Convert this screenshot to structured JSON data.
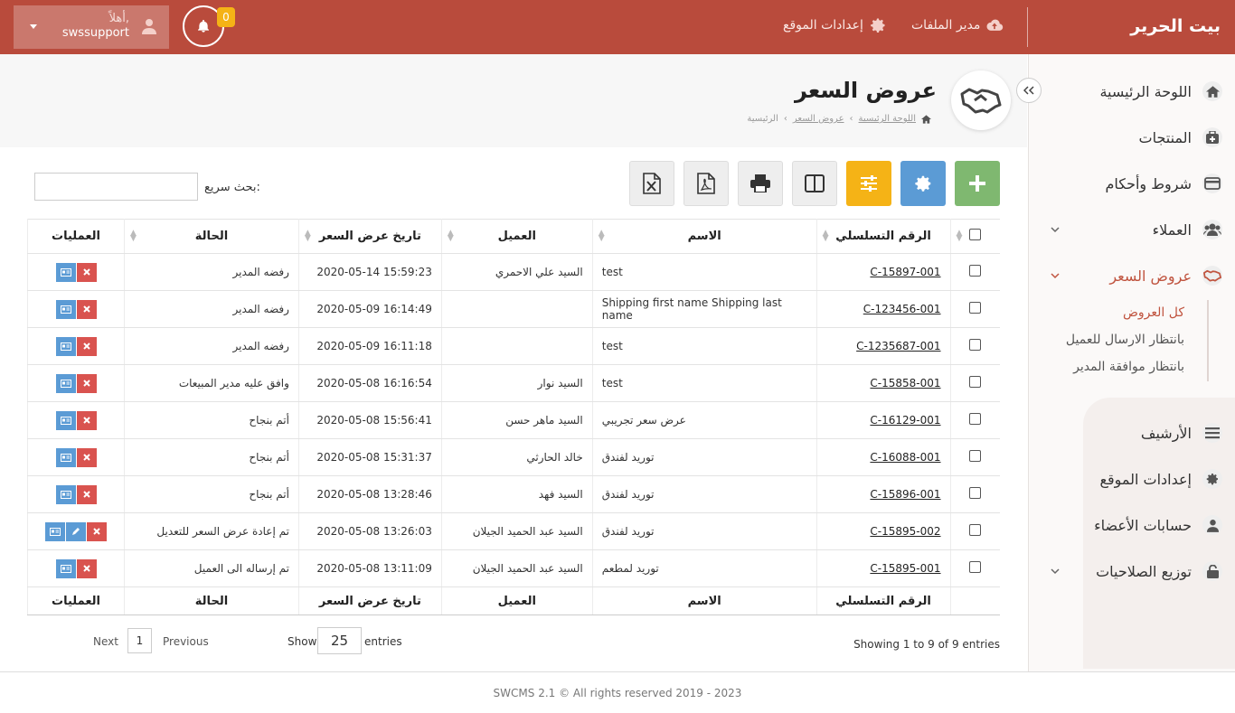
{
  "topbar": {
    "brand": "بيت الحرير",
    "file_manager": "مدير الملفات",
    "site_settings": "إعدادات الموقع",
    "notifications_count": "0",
    "greeting": "أهلاً,",
    "username": "swssupport"
  },
  "sidebar": {
    "items": [
      {
        "label": "اللوحة الرئيسية",
        "icon": "home-icon"
      },
      {
        "label": "المنتجات",
        "icon": "products-icon"
      },
      {
        "label": "شروط وأحكام",
        "icon": "terms-icon"
      },
      {
        "label": "العملاء",
        "icon": "users-icon"
      },
      {
        "label": "عروض السعر",
        "icon": "handshake-icon"
      },
      {
        "label": "الأرشيف",
        "icon": "archive-icon"
      },
      {
        "label": "إعدادات الموقع",
        "icon": "gear-icon"
      },
      {
        "label": "حسابات الأعضاء",
        "icon": "user-icon"
      },
      {
        "label": "توزيع الصلاحيات",
        "icon": "lock-icon"
      }
    ],
    "sub_items": [
      "كل العروض",
      "بانتظار الارسال للعميل",
      "بانتظار موافقة المدير"
    ]
  },
  "page": {
    "title": "عروض السعر",
    "breadcrumb": [
      "اللوحة الرئيسية",
      "عروض السعر",
      "الرئيسية"
    ]
  },
  "toolbar": {
    "search_label": "بحث سريع:",
    "search_value": ""
  },
  "table": {
    "headers": [
      "الرقم التسلسلي",
      "الاسم",
      "العميل",
      "تاريخ عرض السعر",
      "الحالة",
      "العمليات"
    ],
    "rows": [
      {
        "serial": "C-15897-001",
        "name": "test",
        "client": "السيد علي الاحمري",
        "date": "2020-05-14 15:59:23",
        "status": "رفضه المدير",
        "edit": false
      },
      {
        "serial": "C-123456-001",
        "name": "Shipping first name Shipping last name",
        "client": "",
        "date": "2020-05-09 16:14:49",
        "status": "رفضه المدير",
        "edit": false
      },
      {
        "serial": "C-1235687-001",
        "name": "test",
        "client": "",
        "date": "2020-05-09 16:11:18",
        "status": "رفضه المدير",
        "edit": false
      },
      {
        "serial": "C-15858-001",
        "name": "test",
        "client": "السيد نوار",
        "date": "2020-05-08 16:16:54",
        "status": "وافق عليه مدير المبيعات",
        "edit": false
      },
      {
        "serial": "C-16129-001",
        "name": "عرض سعر تجريبي",
        "client": "السيد ماهر حسن",
        "date": "2020-05-08 15:56:41",
        "status": "أتم بنجاح",
        "edit": false
      },
      {
        "serial": "C-16088-001",
        "name": "توريد لفندق",
        "client": "خالد الحارثي",
        "date": "2020-05-08 15:31:37",
        "status": "أتم بنجاح",
        "edit": false
      },
      {
        "serial": "C-15896-001",
        "name": "توريد لفندق",
        "client": "السيد فهد",
        "date": "2020-05-08 13:28:46",
        "status": "أتم بنجاح",
        "edit": false
      },
      {
        "serial": "C-15895-002",
        "name": "توريد لفندق",
        "client": "السيد عبد الحميد الجيلان",
        "date": "2020-05-08 13:26:03",
        "status": "تم إعادة عرض السعر للتعديل",
        "edit": true
      },
      {
        "serial": "C-15895-001",
        "name": "توريد لمطعم",
        "client": "السيد عبد الحميد الجيلان",
        "date": "2020-05-08 13:11:09",
        "status": "تم إرساله الى العميل",
        "edit": false
      }
    ]
  },
  "pagination": {
    "next": "Next",
    "page": "1",
    "previous": "Previous",
    "show": "Show",
    "page_size": "25",
    "entries": "entries",
    "info": "Showing 1 to 9 of 9 entries"
  },
  "footer": "SWCMS 2.1 © All rights reserved 2019 - 2023",
  "colors": {
    "topbar": "#b94b3c",
    "accent": "#c0543f",
    "add": "#7fb870",
    "settings": "#5b9bd5",
    "filter": "#f5b316",
    "delete": "#d9534f"
  }
}
